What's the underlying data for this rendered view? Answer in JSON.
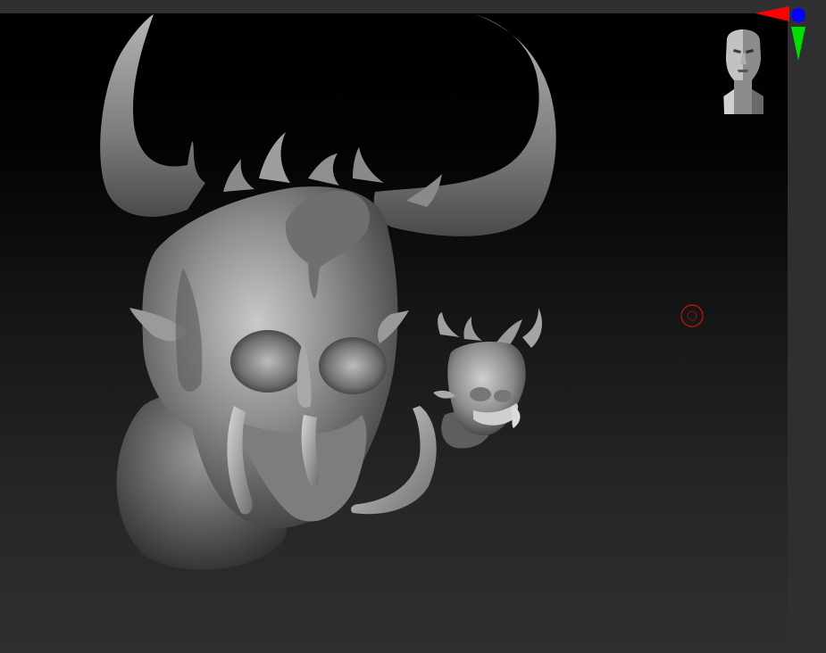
{
  "app": {
    "title": ""
  },
  "viewport": {
    "background_top": "#000000",
    "background_bottom": "#2f2f2f",
    "objects": [
      {
        "name": "demon-skull-sculpt-large"
      },
      {
        "name": "demon-skull-sculpt-small"
      }
    ]
  },
  "navigation": {
    "axis_colors": {
      "x": "#ff0000",
      "y": "#00dd00",
      "z": "#0000ff"
    },
    "orientation_icon": "head-orientation-icon"
  },
  "cursor": {
    "icon": "brush-target-ring-icon",
    "color": "#cc1111"
  }
}
